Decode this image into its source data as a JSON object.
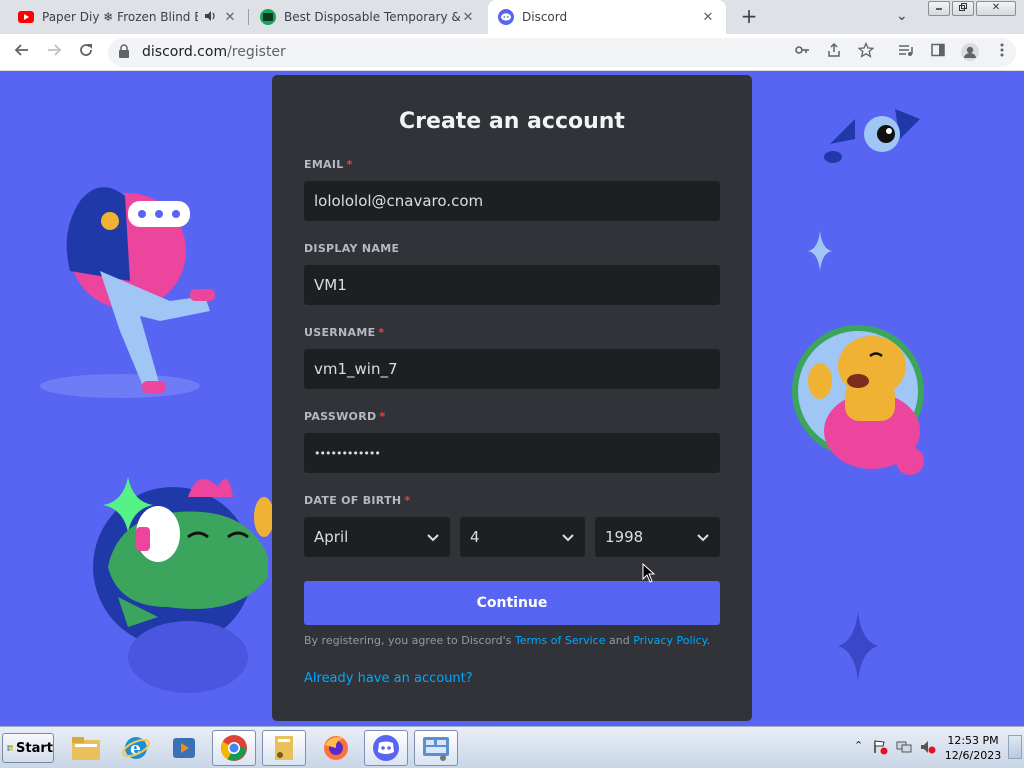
{
  "browser": {
    "tabs": [
      {
        "title": "Paper Diy ❄ Frozen Blind Ba",
        "favicon": "youtube-icon",
        "audio": true
      },
      {
        "title": "Best Disposable Temporary & Fa",
        "favicon": "tempmail-icon"
      },
      {
        "title": "Discord",
        "favicon": "discord-icon",
        "active": true
      }
    ],
    "new_tab": "+",
    "url_domain": "discord.com",
    "url_path": "/register"
  },
  "form": {
    "title": "Create an account",
    "email_label": "EMAIL",
    "email_value": "lolololol@cnavaro.com",
    "display_name_label": "DISPLAY NAME",
    "display_name_value": "VM1",
    "username_label": "USERNAME",
    "username_value": "vm1_win_7",
    "password_label": "PASSWORD",
    "password_value": "••••••••••••",
    "dob_label": "DATE OF BIRTH",
    "dob_month": "April",
    "dob_day": "4",
    "dob_year": "1998",
    "required_mark": "*",
    "continue_label": "Continue",
    "terms_prefix": "By registering, you agree to Discord's ",
    "terms_link": "Terms of Service",
    "terms_and": " and ",
    "privacy_link": "Privacy Policy",
    "terms_suffix": ".",
    "login_link": "Already have an account?"
  },
  "taskbar": {
    "start_label": "Start",
    "apps": [
      "explorer-icon",
      "ie-icon",
      "media-player-icon",
      "chrome-icon",
      "folder-icon",
      "firefox-icon",
      "discord-icon",
      "control-panel-icon"
    ],
    "time": "12:53 PM",
    "date": "12/6/2023"
  },
  "colors": {
    "brand": "#5865f2",
    "card_bg": "#313338",
    "input_bg": "#1e1f22",
    "link": "#00a8fc",
    "required": "#f23f43"
  }
}
